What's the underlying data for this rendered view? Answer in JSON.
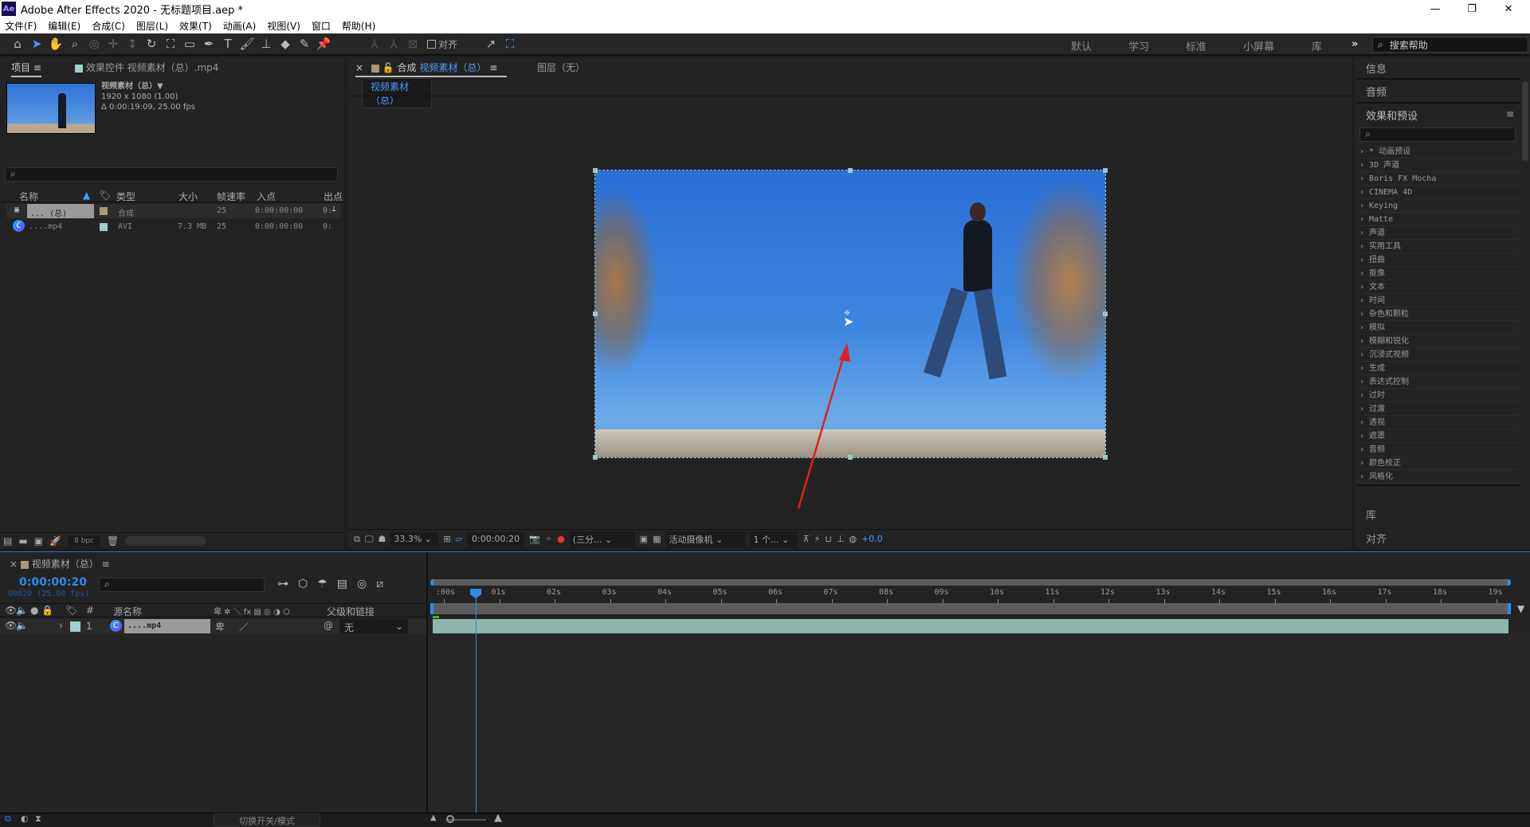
{
  "window": {
    "title": "Adobe After Effects 2020 - 无标题项目.aep *",
    "app_icon": "Ae"
  },
  "menu": [
    "文件(F)",
    "编辑(E)",
    "合成(C)",
    "图层(L)",
    "效果(T)",
    "动画(A)",
    "视图(V)",
    "窗口",
    "帮助(H)"
  ],
  "toolbar": {
    "align_label": "对齐",
    "workspaces": [
      "默认",
      "学习",
      "标准",
      "小屏幕",
      "库"
    ],
    "more": "»",
    "help_search_placeholder": "搜索帮助"
  },
  "project": {
    "tab": "项目",
    "effects_tab": "效果控件 视频素材（总）.mp4",
    "item_name": "视频素材（总）▼",
    "item_res": "1920 x 1080 (1.00)",
    "item_dur": "Δ 0:00:19:09, 25.00 fps",
    "columns": [
      "名称",
      "类型",
      "大小",
      "帧速率",
      "入点",
      "出点"
    ],
    "rows": [
      {
        "name": "... (总)",
        "type": "合成",
        "size": "",
        "fps": "25",
        "in": "0:00:00:00",
        "out": "0:",
        "color": "#a89878"
      },
      {
        "name": "....mp4",
        "type": "AVI",
        "size": "7.3 MB",
        "fps": "25",
        "in": "0:00:00:00",
        "out": "0:",
        "color": "#9fcfcf"
      }
    ],
    "bpc": "8 bpc"
  },
  "viewer": {
    "comp_tab_prefix": "合成",
    "comp_tab_name": "视频素材（总）",
    "layer_tab": "图层（无）",
    "breadcrumb": "视频素材（总）",
    "zoom": "33.3%",
    "time": "0:00:00:20",
    "resolution": "(三分...",
    "camera": "活动摄像机",
    "views": "1 个...",
    "exposure": "+0.0"
  },
  "right": {
    "info": "信息",
    "audio": "音频",
    "effects": "效果和预设",
    "library": "库",
    "align": "对齐",
    "categories": [
      "* 动画预设",
      "3D 声道",
      "Boris FX Mocha",
      "CINEMA 4D",
      "Keying",
      "Matte",
      "声道",
      "实用工具",
      "扭曲",
      "抠像",
      "文本",
      "时间",
      "杂色和颗粒",
      "模拟",
      "模糊和锐化",
      "沉浸式视频",
      "生成",
      "表达式控制",
      "过时",
      "过渡",
      "透视",
      "遮罩",
      "音频",
      "颜色校正",
      "风格化"
    ]
  },
  "timeline": {
    "tab": "视频素材（总）",
    "timecode": "0:00:00:20",
    "frames": "00020 (25.00 fps)",
    "col_source": "源名称",
    "col_parent": "父级和链接",
    "layer": {
      "index": "1",
      "name": "....mp4",
      "parent": "无"
    },
    "ticks": [
      ":00s",
      "01s",
      "02s",
      "03s",
      "04s",
      "05s",
      "06s",
      "07s",
      "08s",
      "09s",
      "10s",
      "11s",
      "12s",
      "13s",
      "14s",
      "15s",
      "16s",
      "17s",
      "18s",
      "19s"
    ],
    "toggle_label": "切换开关/模式"
  },
  "colors": {
    "accent": "#2d8ceb",
    "layer_bar": "#8fb5ad",
    "arrow": "#e02020"
  }
}
